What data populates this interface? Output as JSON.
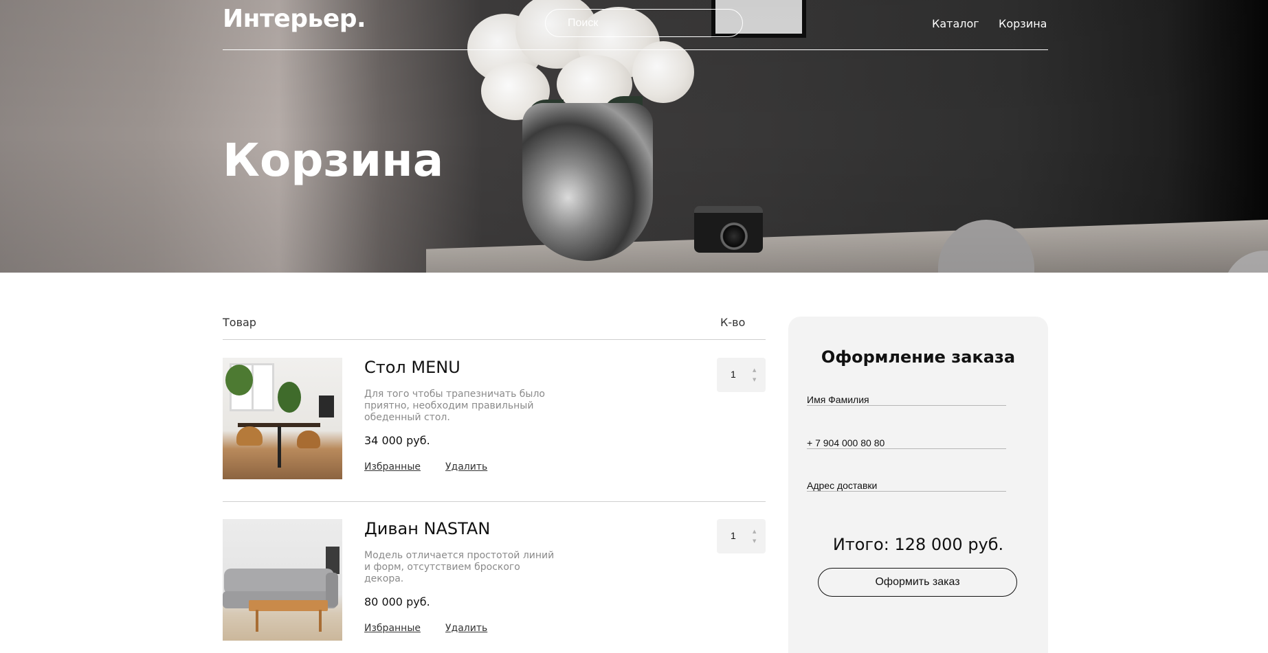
{
  "header": {
    "logo": "Интерьер.",
    "search_placeholder": "Поиск",
    "nav": {
      "catalog": "Каталог",
      "cart": "Корзина"
    }
  },
  "hero": {
    "title": "Корзина"
  },
  "cart": {
    "columns": {
      "product": "Товар",
      "quantity": "К-во"
    },
    "items": [
      {
        "name": "Стол MENU",
        "description": "Для того чтобы трапезничать было приятно, необходим правильный обеденный стол.",
        "price": "34 000 руб.",
        "quantity": "1",
        "favorite_label": "Избранные",
        "delete_label": "Удалить"
      },
      {
        "name": "Диван NASTAN",
        "description": "Модель отличается простотой линий и форм, отсутствием броского декора.",
        "price": "80 000 руб.",
        "quantity": "1",
        "favorite_label": "Избранные",
        "delete_label": "Удалить"
      }
    ]
  },
  "order": {
    "title": "Оформление заказа",
    "fields": {
      "name_placeholder": "Имя Фамилия",
      "phone_placeholder": "+ 7 904 000 80 80",
      "address_placeholder": "Адрес доставки"
    },
    "total": "Итого: 128 000 руб.",
    "submit_label": "Оформить заказ"
  },
  "icons": {
    "qty_up": "chevron-up-icon",
    "qty_down": "chevron-down-icon"
  }
}
